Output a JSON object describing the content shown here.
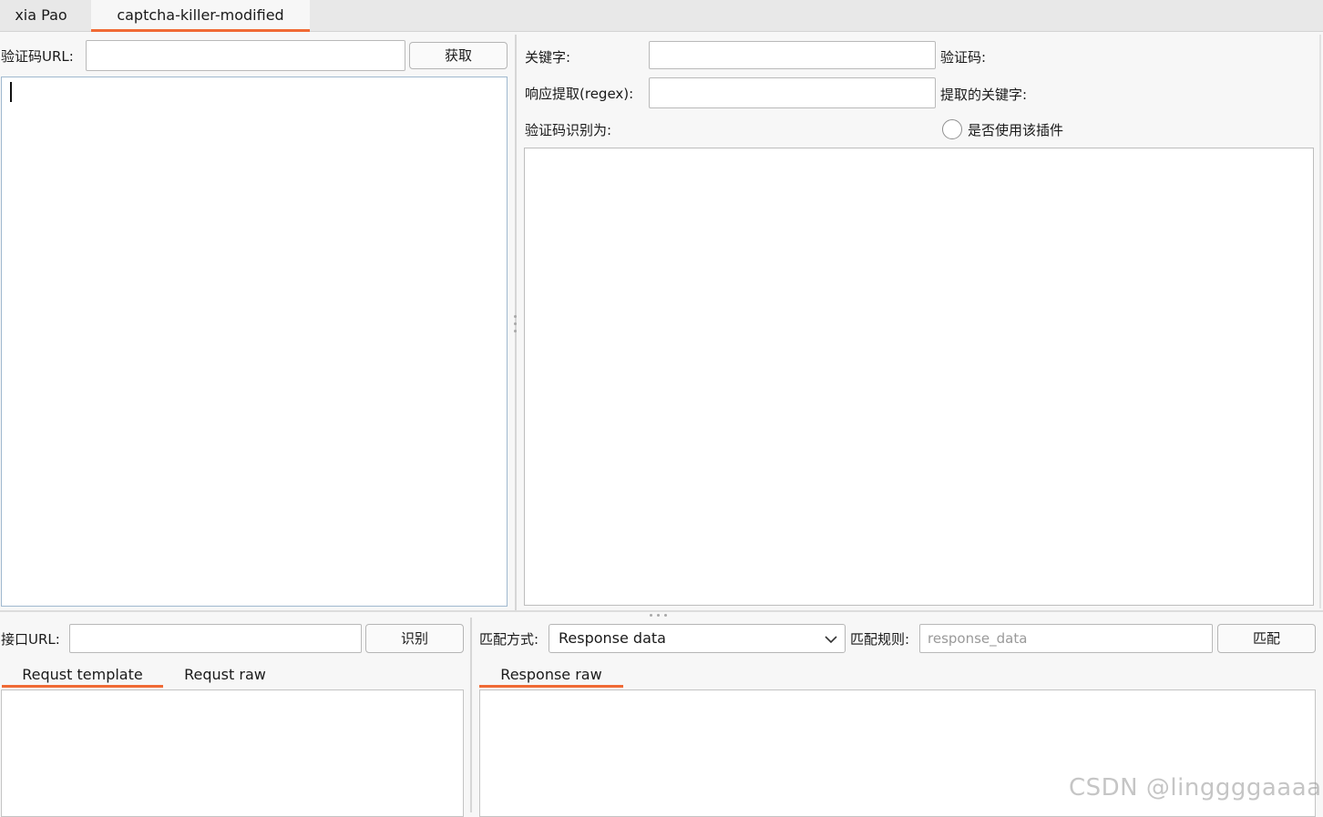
{
  "tabs": [
    {
      "label": "xia Pao",
      "active": false
    },
    {
      "label": "captcha-killer-modified",
      "active": true
    }
  ],
  "captcha_panel": {
    "url_label": "验证码URL:",
    "url_value": "",
    "fetch_button": "获取"
  },
  "keyword_panel": {
    "keyword_label": "关键字:",
    "keyword_value": "",
    "captcha_label": "验证码:",
    "regex_label": "响应提取(regex):",
    "regex_value": "",
    "extracted_keyword_label": "提取的关键字:",
    "recognized_as_label": "验证码识别为:",
    "use_plugin_label": "是否使用该插件",
    "use_plugin_checked": false
  },
  "api_panel": {
    "url_label": "接口URL:",
    "url_value": "",
    "recognize_button": "识别",
    "subtabs": [
      {
        "label": "Requst template",
        "active": true
      },
      {
        "label": "Requst raw",
        "active": false
      }
    ]
  },
  "match_panel": {
    "mode_label": "匹配方式:",
    "mode_value": "Response data",
    "rule_label": "匹配规则:",
    "rule_placeholder": "response_data",
    "match_button": "匹配",
    "subtabs": [
      {
        "label": "Response raw",
        "active": true
      }
    ]
  },
  "icons": {
    "dropdown": "chevron-down-icon",
    "split_grip": "drag-handle-icon"
  },
  "colors": {
    "accent": "#f06a35",
    "background": "#f7f7f7",
    "tabstrip": "#e8e8e8"
  },
  "watermark": "CSDN @linggggaaaa"
}
